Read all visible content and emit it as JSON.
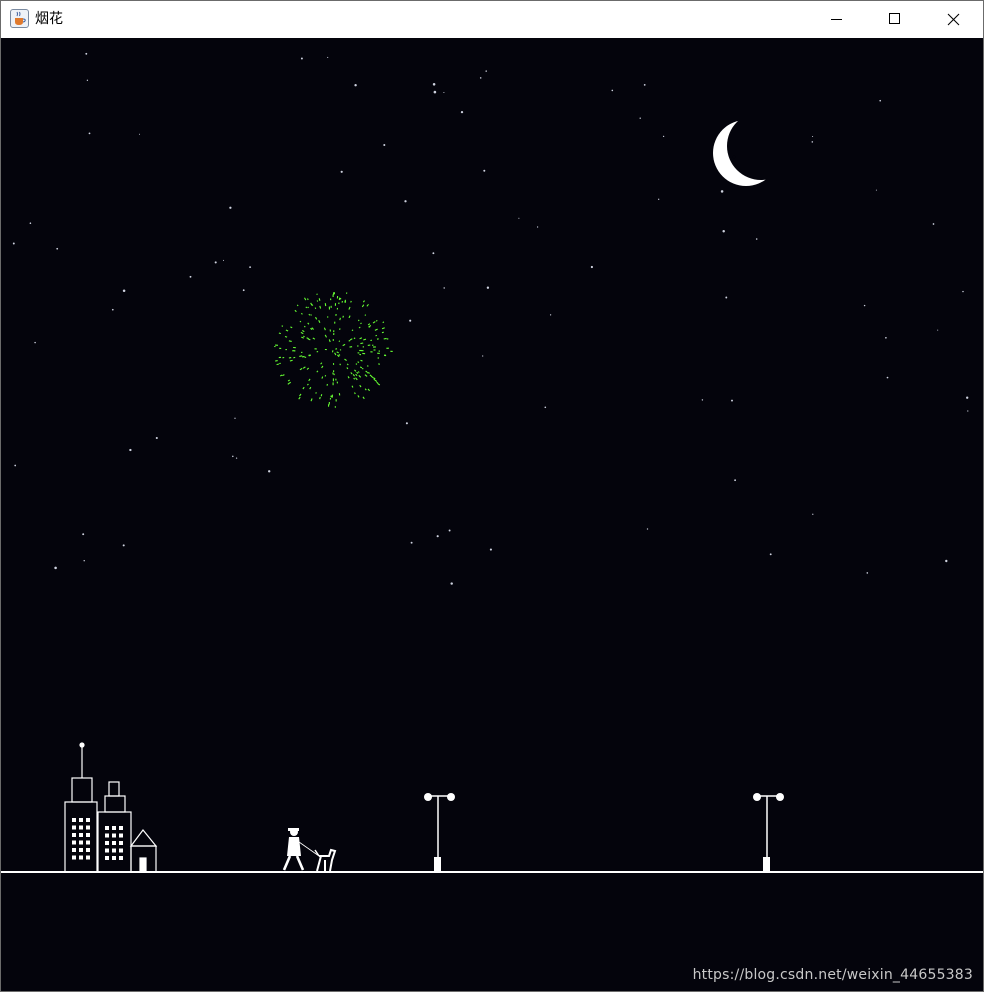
{
  "window": {
    "title": "烟花",
    "icon": "java-coffee-icon",
    "controls": [
      "minimize",
      "maximize",
      "close"
    ]
  },
  "scene": {
    "sky_color": "#04040c",
    "firework_color": "#66ff33",
    "moon_color": "#ffffff",
    "ground_color": "#ffffff",
    "objects": [
      "moon",
      "firework-burst",
      "city-buildings",
      "person-walking-dog",
      "street-lamp",
      "street-lamp"
    ]
  },
  "watermark": "https://blog.csdn.net/weixin_44655383"
}
